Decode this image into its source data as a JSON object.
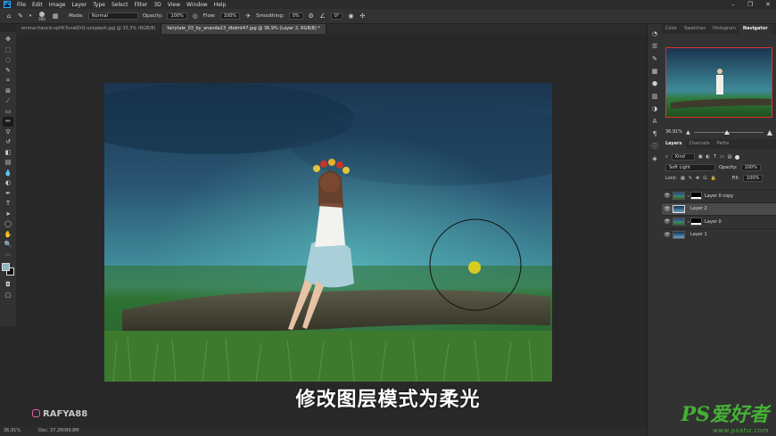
{
  "menu": {
    "items": [
      "File",
      "Edit",
      "Image",
      "Layer",
      "Type",
      "Select",
      "Filter",
      "3D",
      "View",
      "Window",
      "Help"
    ]
  },
  "options": {
    "brush_size": "300",
    "mode_label": "Mode:",
    "mode_value": "Normal",
    "opacity_label": "Opacity:",
    "opacity_value": "100%",
    "flow_label": "Flow:",
    "flow_value": "100%",
    "smoothing_label": "Smoothing:",
    "smoothing_value": "0%",
    "angle_value": "0°"
  },
  "tabs": [
    {
      "label": "emma-francis-vpHCfunwDrQ-unsplash.jpg @ 33,3% (RGB/8)"
    },
    {
      "label": "fairytale_03_by_ananda23_dbdmt47.jpg @ 36,9% (Layer 2, RGB/8) *"
    }
  ],
  "status": {
    "zoom": "36,91%",
    "doc": "Doc: 37,2M/89,8M"
  },
  "subtitle": "修改图层模式为柔光",
  "watermark": "RAFYA88",
  "logo": {
    "big": "PS爱好者",
    "small": "www.psahz.com"
  },
  "top_panel": {
    "tabs": [
      "Color",
      "Swatches",
      "Histogram",
      "Navigator"
    ],
    "zoom": "36,91%"
  },
  "layers_panel": {
    "tabs": [
      "Layers",
      "Channels",
      "Paths"
    ],
    "filter": "Kind",
    "blend_mode": "Soft Light",
    "opacity_label": "Opacity:",
    "opacity_value": "100%",
    "lock_label": "Lock:",
    "fill_label": "Fill:",
    "fill_value": "100%",
    "layers": [
      {
        "name": "Layer 0 copy"
      },
      {
        "name": "Layer 2"
      },
      {
        "name": "Layer 0"
      },
      {
        "name": "Layer 1"
      }
    ]
  },
  "colors": {
    "accent": "#31a8ff",
    "selection_border": "#dd3333",
    "brush_cursor_dot": "#d7cc22",
    "logo_green": "#45b035"
  }
}
